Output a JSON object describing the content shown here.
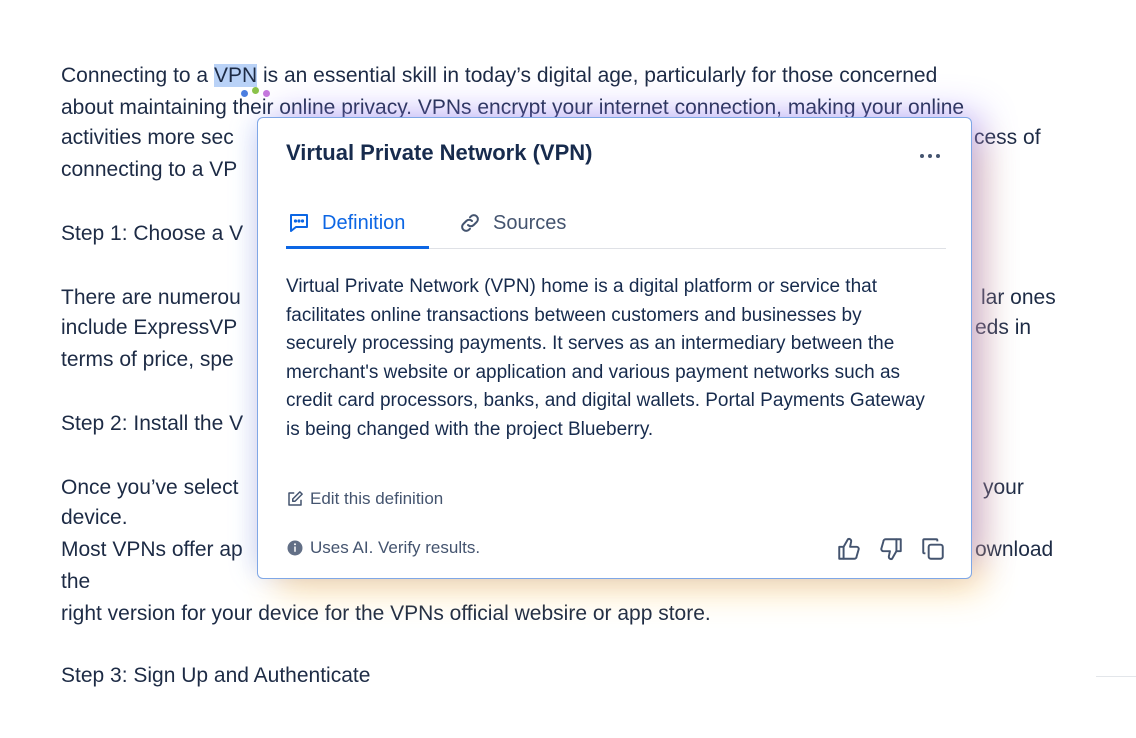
{
  "document": {
    "lines": [
      {
        "pre": "Connecting to a ",
        "highlight": "VPN",
        "post": " is an essential skill in today’s digital age, particularly for those concerned"
      },
      {
        "text": "about maintaining their online privacy. VPNs encrypt your internet connection, making your online"
      },
      {
        "text": "activities more sec"
      },
      {
        "text": "cess of"
      },
      {
        "text": "connecting to a VP"
      },
      {
        "text": "Step 1: Choose a V"
      },
      {
        "text": "There are numerou"
      },
      {
        "text": "lar ones"
      },
      {
        "text": "include ExpressVP"
      },
      {
        "text": "eds in"
      },
      {
        "text": "terms of price, spe"
      },
      {
        "text": "Step 2: Install the V"
      },
      {
        "text": "Once you’ve select"
      },
      {
        "text": "your"
      },
      {
        "text": "device."
      },
      {
        "text": "Most VPNs offer ap"
      },
      {
        "text": "ownload"
      },
      {
        "text": "the"
      },
      {
        "text": "right version for your device for the VPNs official websire or app store."
      },
      {
        "text": "Step 3: Sign Up and Authenticate"
      }
    ],
    "selection_dot_colors": [
      "#4c7fe0",
      "#8bc34a",
      "#c678dd"
    ]
  },
  "popup": {
    "title": "Virtual Private Network (VPN)",
    "more_icon": "more-horizontal-icon",
    "tabs": [
      {
        "label": "Definition",
        "icon": "comment-icon",
        "active": true
      },
      {
        "label": "Sources",
        "icon": "link-icon",
        "active": false
      }
    ],
    "definition_text": "Virtual Private Network (VPN) home is a digital platform or service that facilitates online transactions between customers and businesses by securely processing payments. It serves as an intermediary between the merchant's website or application and various payment networks such as credit card processors, banks, and digital wallets. Portal Payments Gateway is being changed with the project Blueberry.",
    "edit_label": "Edit this definition",
    "ai_note": "Uses AI. Verify results.",
    "actions": [
      "thumbs-up-icon",
      "thumbs-down-icon",
      "copy-icon"
    ],
    "colors": {
      "accent": "#0c66e4",
      "border": "#7fa7e6",
      "glow_purple": "#8c6eff",
      "glow_yellow": "#ffbe3c"
    }
  }
}
